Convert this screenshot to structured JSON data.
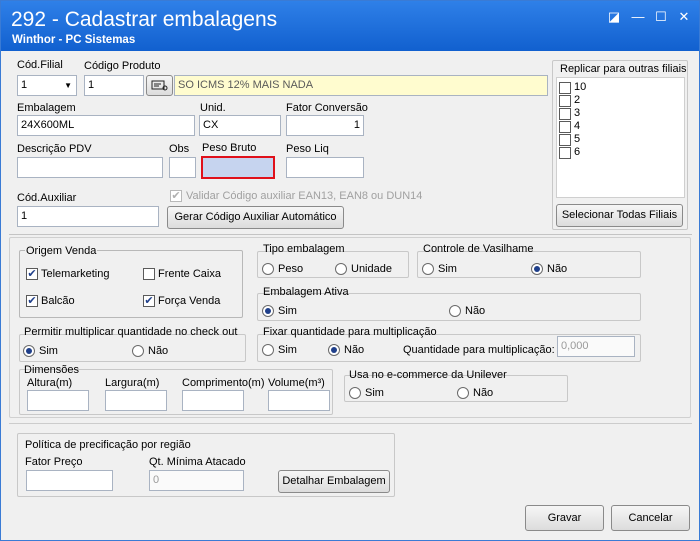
{
  "window": {
    "title": "292 - Cadastrar embalagens",
    "subtitle": "Winthor - PC Sistemas",
    "controls": {
      "restore": "◪",
      "minimize": "—",
      "maximize": "☐",
      "close": "✕"
    }
  },
  "produto": {
    "cod_filial": {
      "label": "Cód.Filial",
      "value": "1"
    },
    "cod_produto": {
      "label": "Código Produto",
      "value": "1"
    },
    "search_icon": "search-icon",
    "descricao_produto": "SO ICMS 12% MAIS NADA"
  },
  "embalagem": {
    "embalagem": {
      "label": "Embalagem",
      "value": "24X600ML"
    },
    "unid": {
      "label": "Unid.",
      "value": "CX"
    },
    "fator_conversao": {
      "label": "Fator Conversão",
      "value": "1"
    },
    "descricao_pdv": {
      "label": "Descrição PDV",
      "value": ""
    },
    "obs": {
      "label": "Obs",
      "value": ""
    },
    "peso_bruto": {
      "label": "Peso Bruto",
      "value": ""
    },
    "peso_liq": {
      "label": "Peso Liq",
      "value": ""
    },
    "cod_auxiliar": {
      "label": "Cód.Auxiliar",
      "value": "1"
    },
    "validar_label": "Validar Código auxiliar EAN13, EAN8 ou DUN14",
    "gerar_button": "Gerar Código Auxiliar Automático"
  },
  "replicar": {
    "title": "Replicar para outras filiais",
    "filiais": [
      "10",
      "2",
      "3",
      "4",
      "5",
      "6"
    ],
    "select_all_button": "Selecionar Todas Filiais"
  },
  "origem_venda": {
    "title": "Origem Venda",
    "telemarketing": "Telemarketing",
    "frente_caixa": "Frente Caixa",
    "balcao": "Balcão",
    "forca_venda": "Força Venda"
  },
  "tipo_embalagem": {
    "title": "Tipo embalagem",
    "peso": "Peso",
    "unidade": "Unidade"
  },
  "controle_vasilhame": {
    "title": "Controle de Vasilhame",
    "sim": "Sim",
    "nao": "Não"
  },
  "embalagem_ativa": {
    "title": "Embalagem Ativa",
    "sim": "Sim",
    "nao": "Não"
  },
  "permitir_multiplicar": {
    "title": "Permitir multiplicar quantidade no check out",
    "sim": "Sim",
    "nao": "Não"
  },
  "fixar_quantidade": {
    "title": "Fixar quantidade para multiplicação",
    "sim": "Sim",
    "nao": "Não",
    "quantidade_label": "Quantidade para multiplicação:",
    "quantidade_value": "0,000"
  },
  "dimensoes": {
    "title": "Dimensões",
    "altura": "Altura(m)",
    "largura": "Largura(m)",
    "comprimento": "Comprimento(m)",
    "volume": "Volume(m³)"
  },
  "ecommerce": {
    "title": "Usa no e-commerce da Unilever",
    "sim": "Sim",
    "nao": "Não"
  },
  "politica": {
    "title": "Política de precificação por região",
    "fator_preco": "Fator Preço",
    "qt_minima": "Qt. Mínima Atacado",
    "qt_minima_value": "0",
    "detalhar_button": "Detalhar Embalagem"
  },
  "actions": {
    "gravar": "Gravar",
    "cancelar": "Cancelar"
  },
  "colors": {
    "titlebar": "#1d6fdc",
    "highlight_field": "#c6d4ef",
    "highlight_border": "#e0101a",
    "product_desc_bg": "#fffccf"
  }
}
